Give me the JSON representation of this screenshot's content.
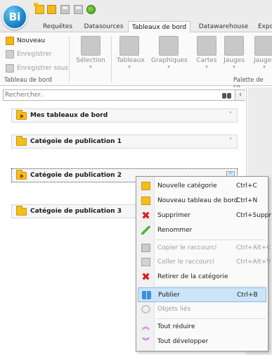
{
  "app": {
    "logo_text": "Bi"
  },
  "tabs": [
    {
      "label": "Requêtes",
      "active": false
    },
    {
      "label": "Datasources",
      "active": false
    },
    {
      "label": "Tableaux de bord",
      "active": true
    },
    {
      "label": "Datawarehouse",
      "active": false
    },
    {
      "label": "Expo",
      "active": false
    }
  ],
  "ribbon": {
    "group_tableau": {
      "label": "Tableau de bord",
      "items": [
        {
          "label": "Nouveau",
          "enabled": true
        },
        {
          "label": "Enregistrer",
          "enabled": false
        },
        {
          "label": "Enregistrer sous",
          "enabled": false
        }
      ]
    },
    "selection": {
      "label": "Sélection"
    },
    "palette": {
      "label": "Palette de co",
      "items": [
        {
          "label": "Tableaux"
        },
        {
          "label": "Graphiques"
        },
        {
          "label": "Cartes"
        },
        {
          "label": "Jauges"
        },
        {
          "label": "Jauges"
        }
      ]
    }
  },
  "search": {
    "placeholder": "Rechercher.."
  },
  "publications": [
    {
      "label": "Mes tableaux de bord",
      "chevron": "˅"
    },
    {
      "label": "Catégoie de publication 1",
      "chevron": "˄"
    },
    {
      "label": "Catégoie de publication 2",
      "chevron": "˄"
    },
    {
      "label": "Catégoie de publication 3",
      "chevron": ""
    }
  ],
  "context_menu": [
    {
      "label": "Nouvelle catégorie",
      "shortcut": "Ctrl+C",
      "enabled": true,
      "icon": "folder-icon"
    },
    {
      "label": "Nouveau tableau de bord",
      "shortcut": "Ctrl+N",
      "enabled": true,
      "icon": "dashboard-folder-icon"
    },
    {
      "label": "Supprimer",
      "shortcut": "Ctrl+Suppr",
      "enabled": true,
      "icon": "delete-icon"
    },
    {
      "label": "Renommer",
      "shortcut": "",
      "enabled": true,
      "icon": "pencil-icon"
    },
    {
      "label": "Copier le raccourci",
      "shortcut": "Ctrl+Alt+C",
      "enabled": false,
      "icon": "copy-icon"
    },
    {
      "label": "Coller le raccourci",
      "shortcut": "Ctrl+Alt+V",
      "enabled": false,
      "icon": "paste-icon"
    },
    {
      "label": "Retirer de la catégorie",
      "shortcut": "",
      "enabled": true,
      "icon": "remove-icon"
    },
    {
      "label": "Publier",
      "shortcut": "Ctrl+B",
      "enabled": true,
      "icon": "publish-icon"
    },
    {
      "label": "Objets liés",
      "shortcut": "",
      "enabled": false,
      "icon": "link-icon"
    },
    {
      "label": "Tout réduire",
      "shortcut": "",
      "enabled": true,
      "icon": "collapse-all-icon"
    },
    {
      "label": "Tout développer",
      "shortcut": "",
      "enabled": true,
      "icon": "expand-all-icon"
    }
  ]
}
